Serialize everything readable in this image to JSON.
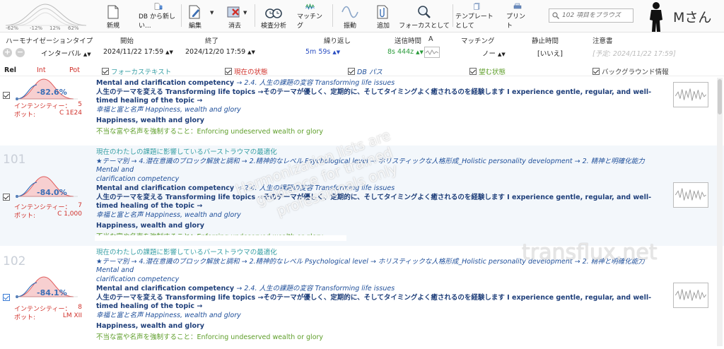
{
  "mini_chart": {
    "ticks": [
      "-62%",
      "-12%",
      "12%",
      "62%"
    ]
  },
  "toolbar": {
    "new": "新規",
    "db_new": "DB から新しい...",
    "edit": "編集",
    "delete": "消去",
    "inspect": "検査分析",
    "matching": "マッチング",
    "vibration": "振動",
    "add": "追加",
    "as_focus": "フォーカスとして",
    "as_template": "テンプレートとして",
    "print": "プリント"
  },
  "search": {
    "placeholder": "102 項目をブラウズ"
  },
  "user": {
    "name": "Mさん"
  },
  "header": {
    "harmonization_type": "ハーモナイゼーションタイプ",
    "start": "開始",
    "end": "終了",
    "repeat": "繰り返し",
    "send_time": "送信時間",
    "a": "A",
    "matching": "マッチング",
    "rest_time": "静止時間",
    "note": "注意書"
  },
  "values": {
    "interval": "インターバル",
    "start_date": "2024/11/22 17:59",
    "end_date": "2024/12/20 17:59",
    "repeat": "5m 59s",
    "send_time": "8s 444z",
    "matching": "ノー",
    "rest_time": "[いいえ]",
    "note": "[予定: 2024/11/22 17:59]"
  },
  "columns": {
    "rel": "Rel",
    "int": "Int",
    "pot": "Pot",
    "focus_text": "フォーカステキスト",
    "current_state": "現在の状態",
    "db_path": "DB パス",
    "desired_state": "望む状態",
    "background_info": "バックグラウンド情報"
  },
  "colors": {
    "teal": "#3aa0a6",
    "blue": "#1f4f9a",
    "green": "#5e9e2a",
    "red": "#d0302a"
  },
  "rows": [
    {
      "number": "",
      "percent": "-82.6%",
      "intensity_label": "インテンシティー：",
      "intensity": "5",
      "pot_label": "ポット:",
      "pot": "C 1E24",
      "title": "",
      "path1": "",
      "path1_cont": "",
      "topic_bold": "Mental and clarification competency",
      "topic_ital": "→ 2.4. 人生の課題の変容 Transforming life issues",
      "theme_bold": "人生のテーマを変える Transforming life topics →そのテーマが優しく、定期的に、そしてタイミングよく癒されるのを経験します I experience gentle, regular, and well-timed healing of the topic →",
      "theme_ital": "幸福と富と名声 Happiness, wealth and glory",
      "happiness": "Happiness, wealth and glory",
      "enforce": "不当な富や名声を強制すること：Enforcing undeserved wealth or glory"
    },
    {
      "number": "101",
      "percent": "-84.0%",
      "intensity_label": "インテンシティー：",
      "intensity": "7",
      "pot_label": "ポット:",
      "pot": "C 1,000",
      "title": "現在のわたしの課題に影響しているバーストラウマの最適化",
      "path1": "★テーマ別 → 4.潜在意識のブロック解放と調和 → 2.精神的なレベル Psychological level → ホリスティックな人格形成_Holistic personality development → 2. 精神と明確化能力 Mental and",
      "path1_cont": "clarification competency",
      "topic_bold": "Mental and clarification competency",
      "topic_ital": "→ 2.4. 人生の課題の変容 Transforming life issues",
      "theme_bold": "人生のテーマを変える Transforming life topics →そのテーマが優しく、定期的に、そしてタイミングよく癒されるのを経験します I experience gentle, regular, and well-timed healing of the topic →",
      "theme_ital": "幸福と富と名声 Happiness, wealth and glory",
      "happiness": "Happiness, wealth and glory",
      "enforce": "不当な富や名声を強制すること：Enforcing undeserved wealth or glory"
    },
    {
      "number": "102",
      "percent": "-84.1%",
      "intensity_label": "インテンシティー：",
      "intensity": "8",
      "pot_label": "ポット:",
      "pot": "LM XII",
      "title": "現在のわたしの課題に影響しているバーストラウマの最適化",
      "path1": "★テーマ別 → 4.潜在意識のブロック解放と調和 → 2.精神的なレベル Psychological level → ホリスティックな人格形成_Holistic personality development → 2. 精神と明確化能力 Mental and",
      "path1_cont": "clarification competency",
      "topic_bold": "Mental and clarification competency",
      "topic_ital": "→ 2.4. 人生の課題の変容 Transforming life issues",
      "theme_bold": "人生のテーマを変える Transforming life topics →そのテーマが優しく、定期的に、そしてタイミングよく癒されるのを経験します I experience gentle, regular, and well-timed healing of the topic →",
      "theme_ital": "幸福と富と名声 Happiness, wealth and glory",
      "happiness": "Happiness, wealth and glory",
      "enforce": "不当な富や名声を強制すること：Enforcing undeserved wealth or glory"
    }
  ],
  "watermarks": {
    "line1": "Harmonization lists are",
    "line2": "guidance for trained",
    "line3": "professionals only",
    "site": "transflux.net"
  }
}
